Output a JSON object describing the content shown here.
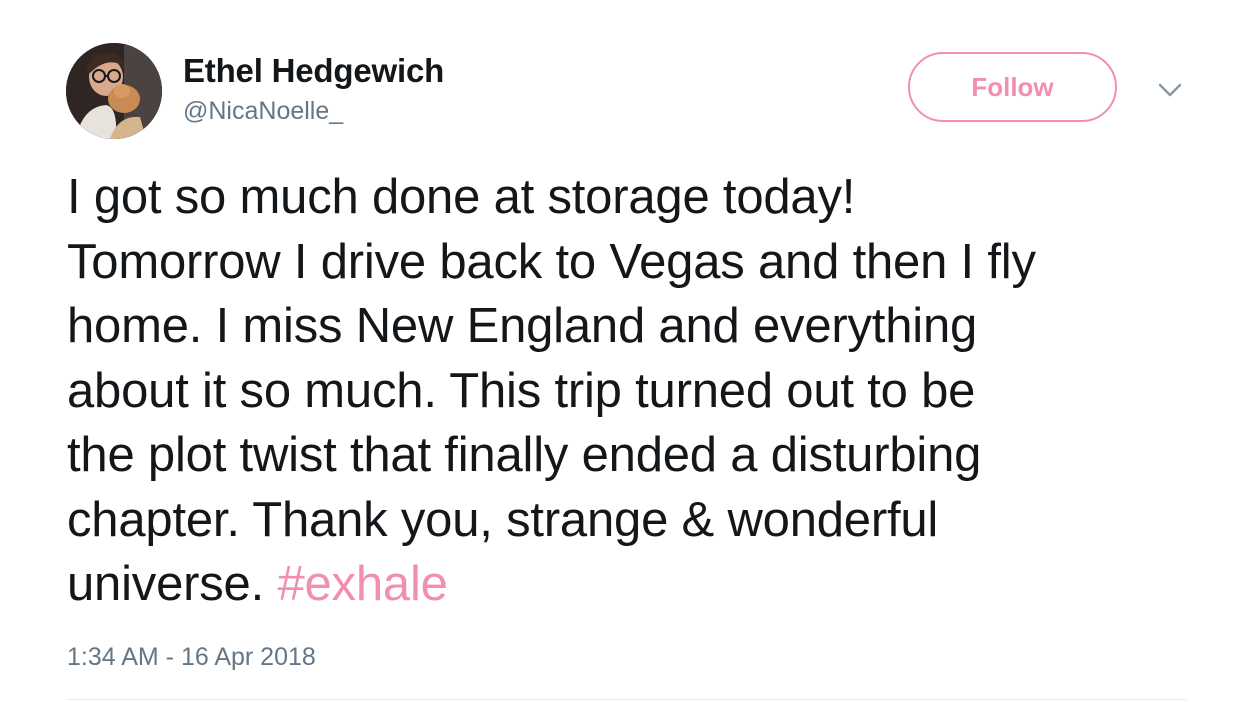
{
  "user": {
    "display_name": "Ethel Hedgewich",
    "handle": "@NicaNoelle_",
    "avatar": "profile-photo"
  },
  "actions": {
    "follow_label": "Follow",
    "more_icon": "chevron-down-icon"
  },
  "tweet": {
    "lines": [
      "I got so much done at storage today!",
      "Tomorrow I drive back to Vegas and then I fly",
      "home. I miss New England and everything",
      "about it so much. This trip turned out to be",
      "the plot twist that finally ended a disturbing",
      "chapter. Thank you, strange & wonderful",
      "universe."
    ],
    "hashtag": "#exhale",
    "timestamp": "1:34 AM - 16 Apr 2018"
  },
  "colors": {
    "accent": "#f08fb3",
    "text": "#14171a",
    "secondary": "#657786",
    "divider": "#e6ecf0"
  }
}
